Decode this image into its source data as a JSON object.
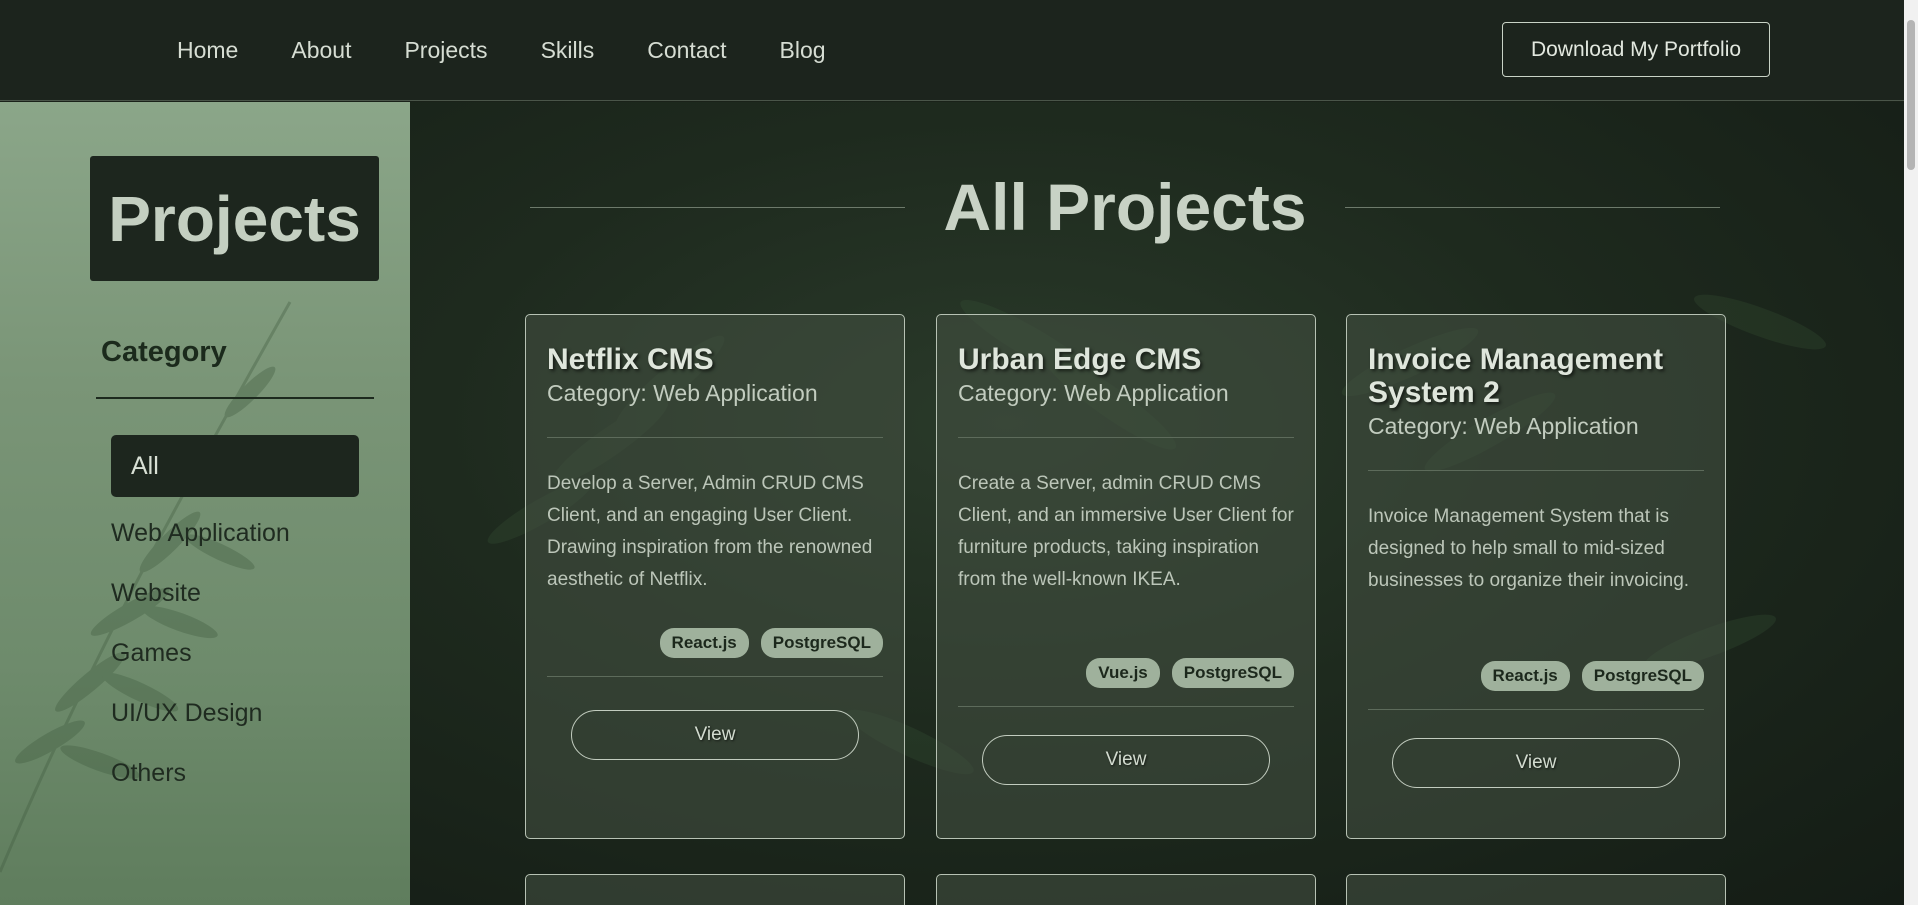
{
  "nav": {
    "links": [
      "Home",
      "About",
      "Projects",
      "Skills",
      "Contact",
      "Blog"
    ],
    "download_label": "Download My Portfolio"
  },
  "sidebar": {
    "title": "Projects",
    "category_heading": "Category",
    "categories": [
      "All",
      "Web Application",
      "Website",
      "Games",
      "UI/UX Design",
      "Others"
    ],
    "active_category": "All"
  },
  "main": {
    "heading": "All Projects",
    "cards": [
      {
        "title": "Netflix CMS",
        "category": "Category: Web Application",
        "description": "Develop a Server, Admin CRUD CMS Client, and an engaging User Client. Drawing inspiration from the renowned aesthetic of Netflix.",
        "tags": [
          "React.js",
          "PostgreSQL"
        ],
        "view_label": "View"
      },
      {
        "title": "Urban Edge CMS",
        "category": "Category: Web Application",
        "description": "Create a Server, admin CRUD CMS Client, and an immersive User Client for furniture products, taking inspiration from the well-known IKEA.",
        "tags": [
          "Vue.js",
          "PostgreSQL"
        ],
        "view_label": "View"
      },
      {
        "title": "Invoice Management System 2",
        "category": "Category: Web Application",
        "description": "Invoice Management System that is designed to help small to mid-sized businesses to organize their invoicing.",
        "tags": [
          "React.js",
          "PostgreSQL"
        ],
        "view_label": "View"
      }
    ]
  },
  "colors": {
    "topbar": "#1c241d",
    "sidebar": "#7a9577",
    "accent_dark": "#1d261e",
    "tag": "#9fb19c"
  }
}
